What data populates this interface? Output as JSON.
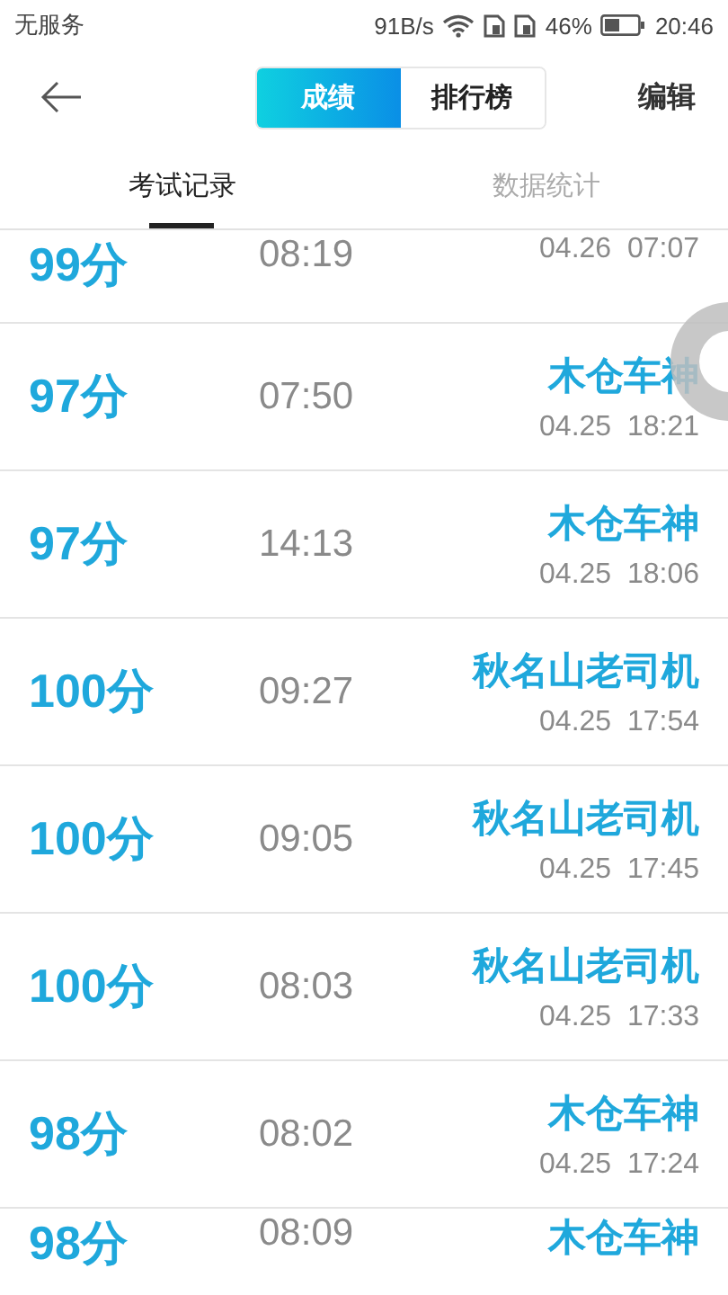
{
  "status_bar": {
    "carrier": "无服务",
    "speed": "91B/s",
    "battery": "46%",
    "time": "20:46"
  },
  "header": {
    "segments": [
      {
        "label": "成绩",
        "selected": true
      },
      {
        "label": "排行榜",
        "selected": false
      }
    ],
    "edit": "编辑"
  },
  "tabs": [
    {
      "label": "考试记录",
      "selected": true
    },
    {
      "label": "数据统计",
      "selected": false
    }
  ],
  "records": [
    {
      "score": "99分",
      "duration": "08:19",
      "date": "04.26  07:07"
    },
    {
      "score": "97分",
      "duration": "07:50",
      "name": "木仓车神",
      "date": "04.25  18:21"
    },
    {
      "score": "97分",
      "duration": "14:13",
      "name": "木仓车神",
      "date": "04.25  18:06"
    },
    {
      "score": "100分",
      "duration": "09:27",
      "name": "秋名山老司机",
      "date": "04.25  17:54"
    },
    {
      "score": "100分",
      "duration": "09:05",
      "name": "秋名山老司机",
      "date": "04.25  17:45"
    },
    {
      "score": "100分",
      "duration": "08:03",
      "name": "秋名山老司机",
      "date": "04.25  17:33"
    },
    {
      "score": "98分",
      "duration": "08:02",
      "name": "木仓车神",
      "date": "04.25  17:24"
    },
    {
      "score": "98分",
      "duration": "08:09",
      "name": "木仓车神"
    }
  ]
}
